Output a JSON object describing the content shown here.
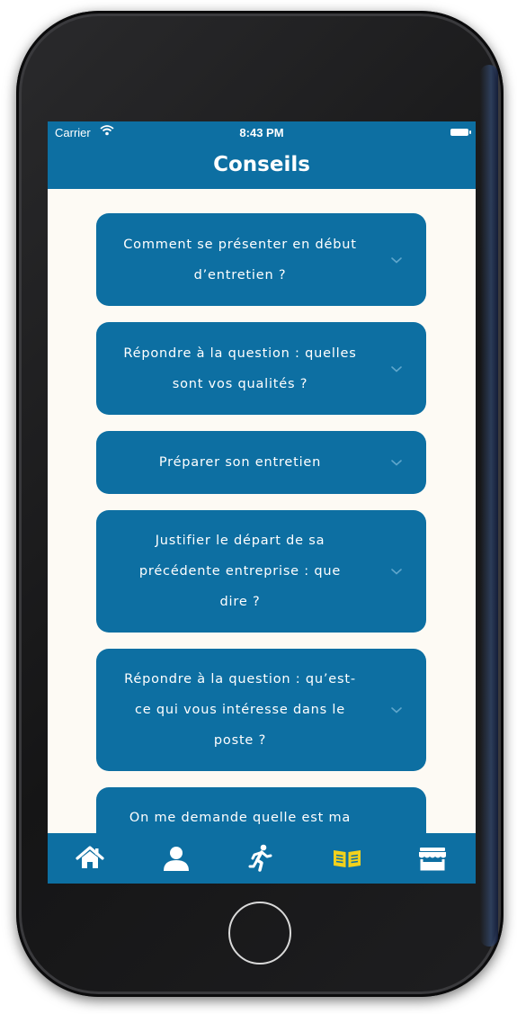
{
  "status_bar": {
    "carrier": "Carrier",
    "time": "8:43 PM"
  },
  "header": {
    "title": "Conseils"
  },
  "accordion": [
    {
      "lines": [
        "Comment se présenter en début",
        "d’entretien ?"
      ]
    },
    {
      "lines": [
        "Répondre à la question : quelles",
        "sont vos qualités ?"
      ]
    },
    {
      "lines": [
        "Préparer son entretien"
      ]
    },
    {
      "lines": [
        "Justifier le départ de sa",
        "précédente entreprise : que",
        "dire ?"
      ]
    },
    {
      "lines": [
        "Répondre à la question : qu’est-",
        "ce qui vous intéresse dans le",
        "poste ?"
      ]
    },
    {
      "lines": [
        "On me demande quelle est ma"
      ]
    }
  ],
  "tabbar": {
    "items": [
      {
        "icon": "home-icon",
        "active": false
      },
      {
        "icon": "user-icon",
        "active": false
      },
      {
        "icon": "running-icon",
        "active": false
      },
      {
        "icon": "book-open-icon",
        "active": true
      },
      {
        "icon": "store-icon",
        "active": false
      }
    ]
  },
  "colors": {
    "primary": "#0d6fa2",
    "background": "#fdfaf4",
    "active_tab": "#f2d11c",
    "text_light": "#ffffff",
    "chevron": "#5fa6cc"
  }
}
